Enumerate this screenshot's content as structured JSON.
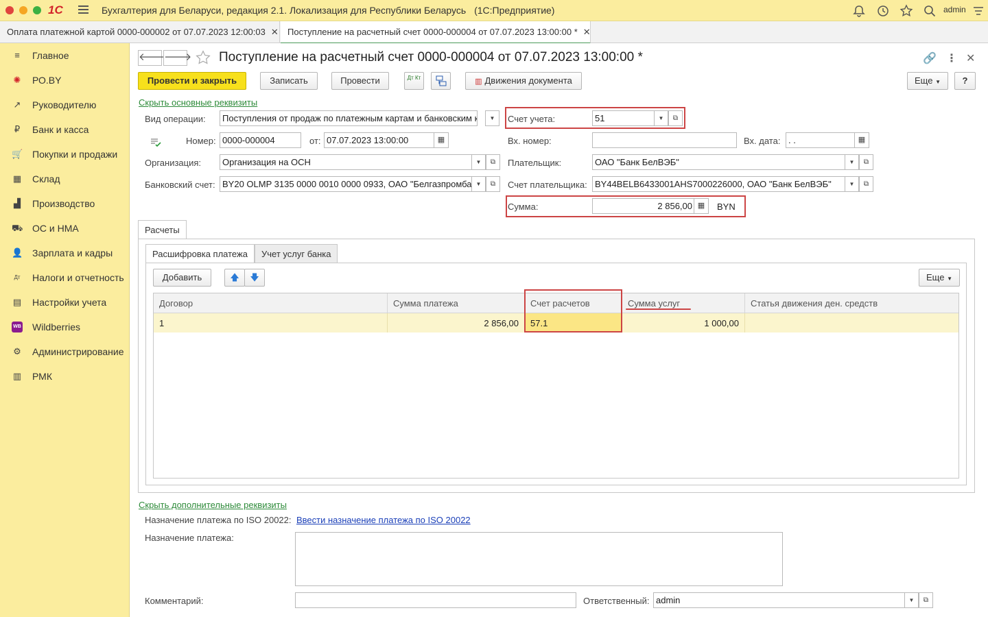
{
  "titlebar": {
    "logo": "1С",
    "app_title": "Бухгалтерия для Беларуси, редакция 2.1. Локализация для Республики Беларусь",
    "platform": "(1С:Предприятие)",
    "user": "admin",
    "icons": [
      "bell-icon",
      "history-icon",
      "star-icon",
      "search-icon",
      "settings-menu-icon"
    ]
  },
  "tabs": [
    {
      "label": "Оплата платежной картой 0000-000002 от 07.07.2023 12:00:03",
      "close": "✕"
    },
    {
      "label": "Поступление на расчетный счет 0000-000004 от 07.07.2023 13:00:00 *",
      "close": "✕"
    }
  ],
  "sidebar": {
    "items": [
      {
        "label": "Главное",
        "icon": "≡"
      },
      {
        "label": "РО.BY",
        "icon": "✺"
      },
      {
        "label": "Руководителю",
        "icon": "↗"
      },
      {
        "label": "Банк и касса",
        "icon": "₽"
      },
      {
        "label": "Покупки и продажи",
        "icon": "🛒"
      },
      {
        "label": "Склад",
        "icon": "▦"
      },
      {
        "label": "Производство",
        "icon": "▟"
      },
      {
        "label": "ОС и НМА",
        "icon": "⛟"
      },
      {
        "label": "Зарплата и кадры",
        "icon": "👤"
      },
      {
        "label": "Налоги и отчетность",
        "icon": "Дт"
      },
      {
        "label": "Настройки учета",
        "icon": "▤"
      },
      {
        "label": "Wildberries",
        "icon": "WB"
      },
      {
        "label": "Администрирование",
        "icon": "⚙"
      },
      {
        "label": "РМК",
        "icon": "▥"
      }
    ]
  },
  "header": {
    "back": "🡐",
    "forward": "🡒",
    "title": "Поступление на расчетный счет 0000-000004 от 07.07.2023 13:00:00 *",
    "link_icon": "🔗",
    "more_icon": "⋮",
    "close_icon": "✕"
  },
  "toolbar": {
    "post_close": "Провести и закрыть",
    "save": "Записать",
    "post": "Провести",
    "dt_kt": "Дт Кт",
    "movements": "Движения документа",
    "more": "Еще",
    "help": "?"
  },
  "form": {
    "hide_main_link": "Скрыть основные реквизиты",
    "operation_label": "Вид операции:",
    "operation_value": "Поступления от продаж по платежным картам и банковским кр",
    "number_label": "Номер:",
    "number_value": "0000-000004",
    "from_label": "от:",
    "date_value": "07.07.2023 13:00:00",
    "org_label": "Организация:",
    "org_value": "Организация на ОСН",
    "bank_account_label": "Банковский счет:",
    "bank_account_value": "BY20 OLMP 3135 0000 0010 0000 0933, ОАО \"Белгазпромба",
    "account_label": "Счет учета:",
    "account_value": "51",
    "in_number_label": "Вх. номер:",
    "in_number_value": "",
    "in_date_label": "Вх. дата:",
    "in_date_value": " .  .",
    "payer_label": "Плательщик:",
    "payer_value": "ОАО \"Банк БелВЭБ\"",
    "payer_account_label": "Счет плательщика:",
    "payer_account_value": "BY44BELB6433001AHS7000226000, ОАО \"Банк БелВЭБ\"",
    "sum_label": "Сумма:",
    "sum_value": "2 856,00",
    "currency": "BYN"
  },
  "calc": {
    "group_tab": "Расчеты",
    "subtab_decode": "Расшифровка платежа",
    "subtab_bank": "Учет услуг банка",
    "add": "Добавить",
    "more": "Еще",
    "columns": [
      "Договор",
      "Сумма платежа",
      "Счет расчетов",
      "Сумма услуг",
      "Статья движения ден. средств"
    ],
    "rows": [
      {
        "contract": "1",
        "payment_sum": "2 856,00",
        "account": "57.1",
        "services_sum": "1 000,00",
        "cash_flow": ""
      }
    ]
  },
  "extra": {
    "hide_extra_link": "Скрыть дополнительные реквизиты",
    "iso_label": "Назначение платежа по ISO 20022:",
    "iso_link": "Ввести назначение платежа по ISO 20022",
    "purpose_label": "Назначение платежа:",
    "purpose_value": "",
    "comment_label": "Комментарий:",
    "comment_value": "",
    "responsible_label": "Ответственный:",
    "responsible_value": "admin"
  },
  "colors": {
    "sidebar_bg": "#fbed9e",
    "primary_button": "#f7e01c",
    "highlight_border": "#cc4444",
    "link_green": "#2e8b3a",
    "row_highlight": "#fbf5cd"
  }
}
